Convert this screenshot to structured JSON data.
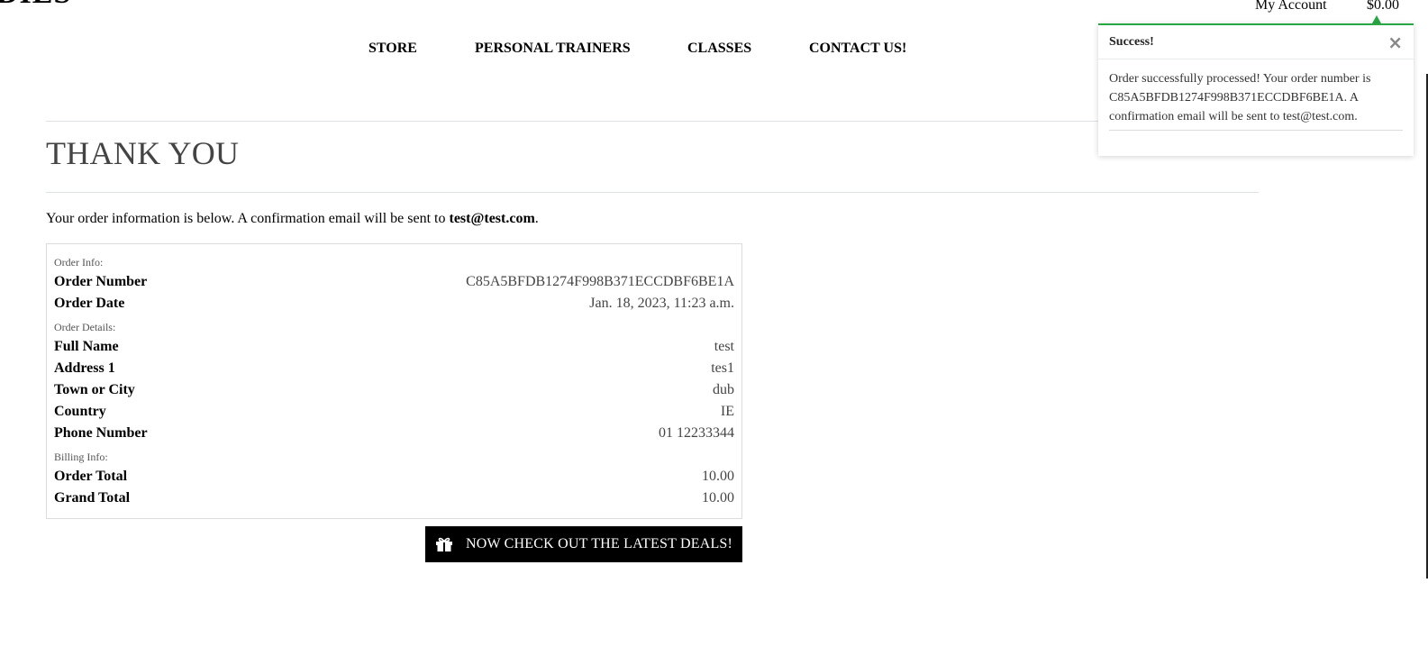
{
  "header": {
    "brand": "DIES",
    "account_label": "My Account",
    "cart_total": "$0.00"
  },
  "nav": {
    "items": [
      {
        "label": "STORE"
      },
      {
        "label": "PERSONAL TRAINERS"
      },
      {
        "label": "CLASSES"
      },
      {
        "label": "CONTACT US!"
      }
    ]
  },
  "main": {
    "title": "THANK YOU",
    "intro_text": "Your order information is below. A confirmation email will be sent to ",
    "intro_email": "test@test.com",
    "intro_end": "."
  },
  "order": {
    "section_order_info": "Order Info:",
    "section_order_details": "Order Details:",
    "section_billing": "Billing Info:",
    "rows": [
      {
        "label": "Order Number",
        "value": "C85A5BFDB1274F998B371ECCDBF6BE1A"
      },
      {
        "label": "Order Date",
        "value": "Jan. 18, 2023, 11:23 a.m."
      },
      {
        "label": "Full Name",
        "value": "test"
      },
      {
        "label": "Address 1",
        "value": "tes1"
      },
      {
        "label": "Town or City",
        "value": "dub"
      },
      {
        "label": "Country",
        "value": "IE"
      },
      {
        "label": "Phone Number",
        "value": "01 12233344"
      },
      {
        "label": "Order Total",
        "value": "10.00"
      },
      {
        "label": "Grand Total",
        "value": "10.00"
      }
    ]
  },
  "deals_button": {
    "label": "NOW CHECK OUT THE LATEST DEALS!",
    "icon": "gift-icon"
  },
  "toast": {
    "title": "Success!",
    "close_glyph": "×",
    "message": "Order successfully processed! Your order number is C85A5BFDB1274F998B371ECCDBF6BE1A. A confirmation email will be sent to test@test.com.",
    "accent_color": "#28a745"
  }
}
